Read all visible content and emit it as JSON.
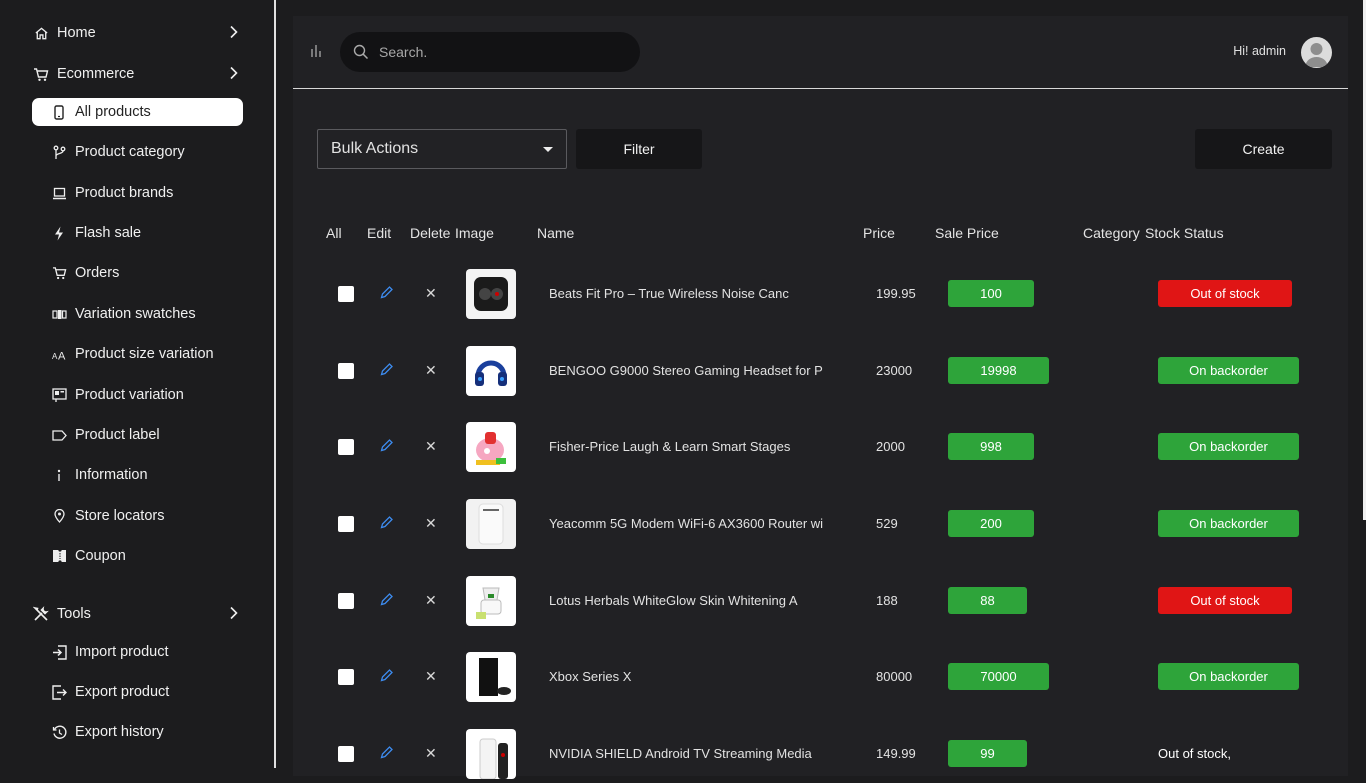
{
  "sidebar": {
    "home": "Home",
    "ecommerce": "Ecommerce",
    "items": [
      {
        "label": "All products",
        "icon": "phone-icon"
      },
      {
        "label": "Product category",
        "icon": "branch-icon"
      },
      {
        "label": "Product brands",
        "icon": "laptop-icon"
      },
      {
        "label": "Flash sale",
        "icon": "bolt-icon"
      },
      {
        "label": "Orders",
        "icon": "cart-icon"
      },
      {
        "label": "Variation swatches",
        "icon": "swatch-icon"
      },
      {
        "label": "Product size variation",
        "icon": "text-size-icon"
      },
      {
        "label": "Product variation",
        "icon": "variation-icon"
      },
      {
        "label": "Product label",
        "icon": "tag-icon"
      },
      {
        "label": "Information",
        "icon": "info-icon"
      },
      {
        "label": "Store locators",
        "icon": "pin-icon"
      },
      {
        "label": "Coupon",
        "icon": "coupon-icon"
      }
    ],
    "tools": "Tools",
    "tool_items": [
      {
        "label": "Import product",
        "icon": "import-icon"
      },
      {
        "label": "Export product",
        "icon": "export-icon"
      },
      {
        "label": "Export history",
        "icon": "history-icon"
      }
    ]
  },
  "header": {
    "search_placeholder": "Search.",
    "greeting": "Hi! admin"
  },
  "toolbar": {
    "bulk_actions": "Bulk Actions",
    "filter": "Filter",
    "create": "Create"
  },
  "table": {
    "headers": {
      "all": "All",
      "edit": "Edit",
      "delete": "Delete",
      "image": "Image",
      "name": "Name",
      "price": "Price",
      "sale_price": "Sale Price",
      "category": "Category",
      "stock_status": "Stock Status"
    },
    "rows": [
      {
        "name": "Beats Fit Pro – True Wireless Noise Canc",
        "price": "199.95",
        "sale": "100",
        "stock": "Out of stock",
        "stock_type": "out"
      },
      {
        "name": "BENGOO G9000 Stereo Gaming Headset for P",
        "price": "23000",
        "sale": "19998",
        "stock": "On backorder",
        "stock_type": "back"
      },
      {
        "name": "Fisher-Price Laugh & Learn Smart Stages",
        "price": "2000",
        "sale": "998",
        "stock": "On backorder",
        "stock_type": "back"
      },
      {
        "name": "Yeacomm 5G Modem WiFi-6 AX3600 Router wi",
        "price": "529",
        "sale": "200",
        "stock": "On backorder",
        "stock_type": "back"
      },
      {
        "name": "Lotus Herbals WhiteGlow Skin Whitening A",
        "price": "188",
        "sale": "88",
        "stock": "Out of stock",
        "stock_type": "out"
      },
      {
        "name": "Xbox Series X",
        "price": "80000",
        "sale": "70000",
        "stock": "On backorder",
        "stock_type": "back"
      },
      {
        "name": "NVIDIA SHIELD Android TV Streaming Media",
        "price": "149.99",
        "sale": "99",
        "stock": "Out of stock,",
        "stock_type": "plain"
      }
    ]
  }
}
